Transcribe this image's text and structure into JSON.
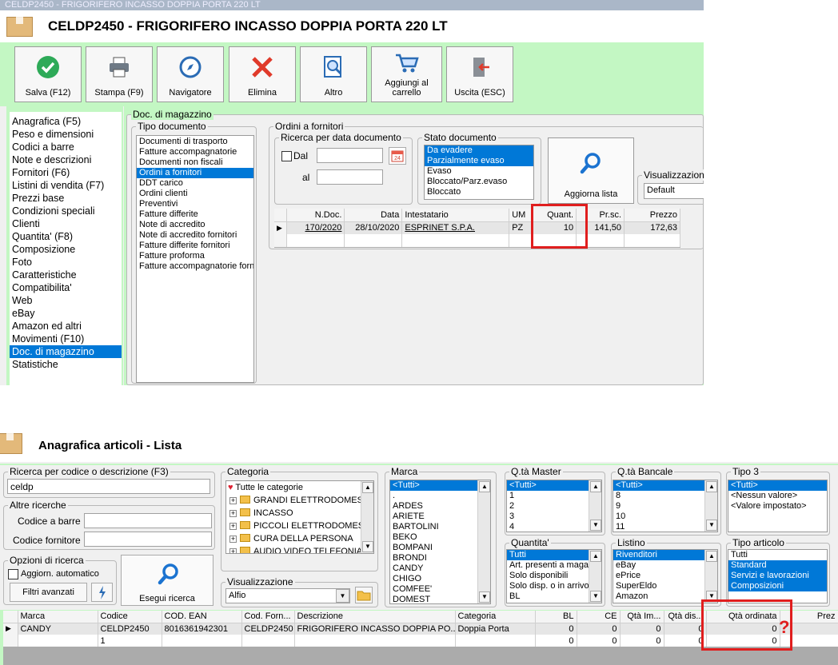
{
  "win1": {
    "titlebar": "CELDP2450 - FRIGORIFERO INCASSO DOPPIA PORTA 220 LT",
    "title": "CELDP2450 - FRIGORIFERO INCASSO DOPPIA PORTA 220 LT",
    "toolbar": [
      {
        "label": "Salva (F12)",
        "icon": "check-icon"
      },
      {
        "label": "Stampa (F9)",
        "icon": "printer-icon"
      },
      {
        "label": "Navigatore",
        "icon": "compass-icon"
      },
      {
        "label": "Elimina",
        "icon": "delete-x-icon"
      },
      {
        "label": "Altro",
        "icon": "search-doc-icon"
      },
      {
        "label": "Aggiungi al carrello",
        "icon": "cart-icon"
      },
      {
        "label": "Uscita (ESC)",
        "icon": "exit-door-icon"
      }
    ],
    "side_menu": [
      "Anagrafica (F5)",
      "Peso e dimensioni",
      "Codici a barre",
      "Note e descrizioni",
      "Fornitori (F6)",
      "Listini di vendita (F7)",
      "Prezzi base",
      "Condizioni speciali",
      "Clienti",
      "Quantita' (F8)",
      "Composizione",
      "Foto",
      "Caratteristiche",
      "Compatibilita'",
      "Web",
      "eBay",
      "Amazon ed altri",
      "Movimenti (F10)",
      "Doc. di magazzino",
      "Statistiche"
    ],
    "side_selected": "Doc. di magazzino",
    "doc_group_label": "Doc. di magazzino",
    "tipo_doc_label": "Tipo documento",
    "tipo_doc": [
      "Documenti di trasporto",
      "Fatture accompagnatorie",
      "Documenti non fiscali",
      "Ordini a fornitori",
      "DDT carico",
      "Ordini clienti",
      "Preventivi",
      "Fatture differite",
      "Note di accredito",
      "Note di accredito fornitori",
      "Fatture differite fornitori",
      "Fatture proforma",
      "Fatture accompagnatorie forn"
    ],
    "tipo_selected": "Ordini a fornitori",
    "ordini_label": "Ordini a fornitori",
    "ricerca_label": "Ricerca per data documento",
    "dal_label": "Dal",
    "al_label": "al",
    "stato_label": "Stato documento",
    "stato": [
      {
        "t": "Da evadere",
        "sel": true
      },
      {
        "t": "Parzialmente evaso",
        "sel": true
      },
      {
        "t": "Evaso",
        "sel": false
      },
      {
        "t": "Bloccato/Parz.evaso",
        "sel": false
      },
      {
        "t": "Bloccato",
        "sel": false
      }
    ],
    "aggiorna_label": "Aggiorna lista",
    "vis_label": "Visualizzazione",
    "vis_value": "Default",
    "grid_headers": [
      "N.Doc.",
      "Data",
      "Intestatario",
      "UM",
      "Quant.",
      "Pr.sc.",
      "Prezzo"
    ],
    "grid_row": [
      "170/2020",
      "28/10/2020",
      "ESPRINET S.P.A.",
      "PZ",
      "10",
      "141,50",
      "172,63"
    ],
    "colors": {
      "accent": "#0078d7",
      "green": "#c3f7c3",
      "red": "#e01e1e"
    }
  },
  "win2": {
    "titlebar": "Anagrafica articoli - Lista",
    "title": "Anagrafica articoli  - Lista",
    "ricerca_label": "Ricerca per codice o descrizione (F3)",
    "ricerca_value": "celdp",
    "altre_label": "Altre ricerche",
    "codbarre_label": "Codice a barre :",
    "codforn_label": "Codice fornitore :",
    "opzioni_label": "Opzioni di ricerca",
    "aggiorn_label": "Aggiorn. automatico",
    "filtri_label": "Filtri avanzati",
    "esegui_label": "Esegui ricerca",
    "categoria_label": "Categoria",
    "categorie": [
      "Tutte le categorie",
      "GRANDI ELETTRODOMESTICI",
      "INCASSO",
      "PICCOLI ELETTRODOMESTICI",
      "CURA DELLA PERSONA",
      "AUDIO VIDEO TELEFONIA"
    ],
    "vis_label": "Visualizzazione",
    "vis_value": "Alfio",
    "marca_label": "Marca",
    "marche": [
      "<Tutti>",
      ".",
      "ARDES",
      "ARIETE",
      "BARTOLINI",
      "BEKO",
      "BOMPANI",
      "BRONDI",
      "CANDY",
      "CHIGO",
      "COMFEE'",
      "DOMEST"
    ],
    "qmaster_label": "Q.tà Master",
    "qmaster": [
      "<Tutti>",
      "1",
      "2",
      "3",
      "4"
    ],
    "qbancale_label": "Q.tà Bancale",
    "qbancale": [
      "<Tutti>",
      "8",
      "9",
      "10",
      "11"
    ],
    "tipo3_label": "Tipo 3",
    "tipo3": [
      "<Tutti>",
      "<Nessun valore>",
      "<Valore impostato>"
    ],
    "quantita_label": "Quantita'",
    "quantita": [
      "Tutti",
      "Art. presenti a magazzino",
      "Solo disponibili",
      "Solo disp. o in arrivo",
      "BL"
    ],
    "listino_label": "Listino",
    "listino": [
      "Rivenditori",
      "eBay",
      "ePrice",
      "SuperEldo",
      "Amazon"
    ],
    "tipoart_label": "Tipo articolo",
    "tipoart": [
      {
        "t": "Tutti",
        "sel": false
      },
      {
        "t": "Standard",
        "sel": true
      },
      {
        "t": "Servizi e lavorazioni",
        "sel": true
      },
      {
        "t": "Composizioni",
        "sel": true
      }
    ],
    "grid_headers": [
      "Marca",
      "Codice",
      "COD. EAN",
      "Cod. Forn...",
      "Descrizione",
      "Categoria",
      "BL",
      "CE",
      "Qtà Im...",
      "Qtà dis...",
      "Qtà ordinata",
      "Prez"
    ],
    "grid_rows": [
      [
        "CANDY",
        "CELDP2450",
        "8016361942301",
        "CELDP2450",
        "FRIGORIFERO INCASSO DOPPIA PO...",
        "Doppia Porta",
        "0",
        "0",
        "0",
        "0",
        "0",
        ""
      ],
      [
        "",
        "1",
        "",
        "",
        "",
        "",
        "0",
        "0",
        "0",
        "0",
        "0",
        ""
      ]
    ],
    "question_mark": "?"
  }
}
